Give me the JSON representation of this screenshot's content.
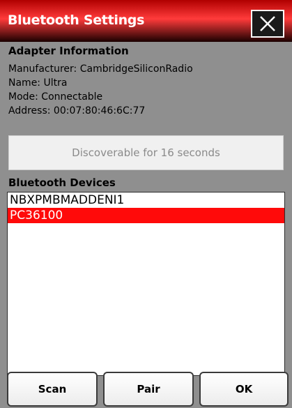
{
  "window": {
    "title": "Bluetooth Settings",
    "close_icon": "close-icon"
  },
  "adapter": {
    "heading": "Adapter Information",
    "manufacturer": "Manufacturer: CambridgeSiliconRadio",
    "name": "Name: Ultra",
    "mode": "Mode: Connectable",
    "address": "Address: 00:07:80:46:6C:77"
  },
  "discoverable": {
    "label": "Discoverable for 16 seconds"
  },
  "devices": {
    "heading": "Bluetooth Devices",
    "items": [
      {
        "label": "NBXPMBMADDENI1",
        "selected": false
      },
      {
        "label": "PC36100",
        "selected": true
      }
    ]
  },
  "buttons": {
    "scan": "Scan",
    "pair": "Pair",
    "ok": "OK"
  },
  "colors": {
    "title_bar": "#e00000",
    "selection": "#ff0a0a",
    "background": "#8f8f8f"
  }
}
